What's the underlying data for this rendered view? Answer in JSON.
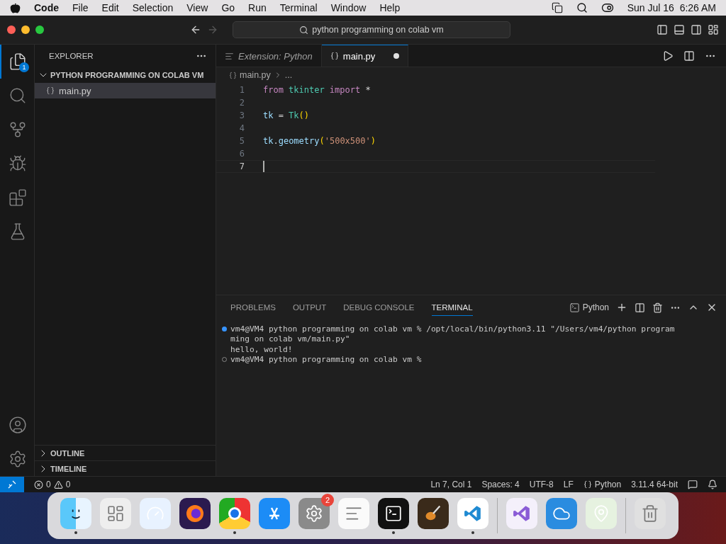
{
  "menu_bar": {
    "app": "Code",
    "items": [
      "File",
      "Edit",
      "Selection",
      "View",
      "Go",
      "Run",
      "Terminal",
      "Window",
      "Help"
    ],
    "clock": "Sun Jul 16  6:26 AM"
  },
  "title_bar": {
    "search": "python programming on colab vm"
  },
  "activity_bar": {
    "top": [
      {
        "kind": "explorer",
        "selected": true,
        "badge": "1"
      },
      {
        "kind": "search",
        "selected": false
      },
      {
        "kind": "source-control",
        "selected": false
      },
      {
        "kind": "run-debug",
        "selected": false
      },
      {
        "kind": "extensions",
        "selected": false
      },
      {
        "kind": "testing",
        "selected": false
      }
    ],
    "bottom": [
      {
        "kind": "accounts",
        "selected": false
      },
      {
        "kind": "settings",
        "selected": false
      }
    ]
  },
  "sidebar": {
    "title": "EXPLORER",
    "folder": {
      "label": "PYTHON PROGRAMMING ON COLAB VM",
      "expanded": true,
      "children": [
        {
          "label": "main.py",
          "selected": true
        }
      ]
    },
    "sections": [
      {
        "label": "OUTLINE",
        "expanded": false
      },
      {
        "label": "TIMELINE",
        "expanded": false
      }
    ]
  },
  "tabs": [
    {
      "label": "Extension: Python",
      "kind": "preview",
      "selected": false,
      "dirty": false
    },
    {
      "label": "main.py",
      "kind": "python",
      "selected": true,
      "dirty": true
    }
  ],
  "breadcrumb": [
    "main.py",
    "..."
  ],
  "code": [
    {
      "number": "1",
      "current": false,
      "tokens": [
        {
          "text": "from",
          "kind": "keyword",
          "spaced": false
        },
        {
          "text": "tkinter",
          "kind": "module",
          "spaced": true
        },
        {
          "text": "import",
          "kind": "keyword",
          "spaced": true
        },
        {
          "text": "*",
          "kind": "operator",
          "spaced": true
        }
      ]
    },
    {
      "number": "2",
      "current": false
    },
    {
      "number": "3",
      "current": false,
      "tokens": [
        {
          "text": "tk",
          "kind": "variable",
          "spaced": false
        },
        {
          "text": "=",
          "kind": "operator",
          "spaced": true
        },
        {
          "text": "Tk",
          "kind": "class",
          "spaced": true
        },
        {
          "text": "()",
          "kind": "paren",
          "spaced": false
        }
      ]
    },
    {
      "number": "4",
      "current": false
    },
    {
      "number": "5",
      "current": false,
      "tokens": [
        {
          "text": "tk",
          "kind": "variable"
        },
        {
          "text": ".",
          "kind": "operator"
        },
        {
          "text": "geometry",
          "kind": "variable"
        },
        {
          "text": "(",
          "kind": "paren"
        },
        {
          "text": "'500x500'",
          "kind": "string"
        },
        {
          "text": ")",
          "kind": "paren"
        }
      ]
    },
    {
      "number": "6",
      "current": false
    },
    {
      "number": "7",
      "current": true
    }
  ],
  "panel": {
    "tabs": [
      {
        "label": "PROBLEMS",
        "selected": false
      },
      {
        "label": "OUTPUT",
        "selected": false
      },
      {
        "label": "DEBUG CONSOLE",
        "selected": false
      },
      {
        "label": "TERMINAL",
        "selected": true
      }
    ],
    "terminal_name": "Python",
    "lines": [
      {
        "kind": "command",
        "text": "vm4@VM4 python programming on colab vm % /opt/local/bin/python3.11 \"/Users/vm4/python program"
      },
      {
        "kind": "output",
        "text": "ming on colab vm/main.py\""
      },
      {
        "kind": "output",
        "text": "hello, world!"
      },
      {
        "kind": "prompt",
        "text": "vm4@VM4 python programming on colab vm %"
      }
    ]
  },
  "status_bar": {
    "errors": "0",
    "warnings": "0",
    "items": [
      {
        "kind": "text",
        "label": "Ln 7, Col 1"
      },
      {
        "kind": "text",
        "label": "Spaces: 4"
      },
      {
        "kind": "text",
        "label": "UTF-8"
      },
      {
        "kind": "text",
        "label": "LF"
      },
      {
        "kind": "language",
        "label": "Python"
      },
      {
        "kind": "text",
        "label": "3.11.4 64-bit"
      }
    ]
  },
  "dock": [
    {
      "kind": "finder",
      "running": true
    },
    {
      "kind": "launchpad",
      "running": false
    },
    {
      "kind": "safari",
      "running": false
    },
    {
      "kind": "firefox",
      "running": false
    },
    {
      "kind": "chrome",
      "running": true
    },
    {
      "kind": "appstore",
      "running": false
    },
    {
      "kind": "settings",
      "running": false,
      "badge": "2"
    },
    {
      "kind": "textedit",
      "running": false
    },
    {
      "kind": "terminal",
      "running": true
    },
    {
      "kind": "garageband",
      "running": false
    },
    {
      "kind": "vscode",
      "running": true
    },
    {
      "kind": "separator"
    },
    {
      "kind": "visualstudio",
      "running": false
    },
    {
      "kind": "weather",
      "running": false
    },
    {
      "kind": "maps",
      "running": false
    },
    {
      "kind": "separator"
    },
    {
      "kind": "trash",
      "running": false
    }
  ]
}
